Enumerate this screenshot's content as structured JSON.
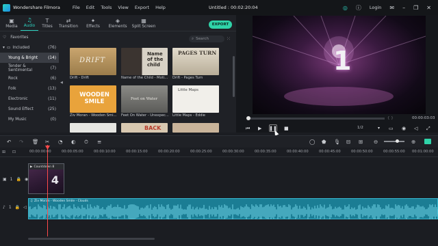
{
  "titlebar": {
    "app_name": "Wondershare Filmora",
    "menus": [
      "File",
      "Edit",
      "Tools",
      "View",
      "Export",
      "Help"
    ],
    "project": "Untitled : 00:02:20:04",
    "login": "Login"
  },
  "tabs": [
    {
      "label": "Media",
      "icon": "▣"
    },
    {
      "label": "Audio",
      "icon": "♫"
    },
    {
      "label": "Titles",
      "icon": "T"
    },
    {
      "label": "Transition",
      "icon": "⇄"
    },
    {
      "label": "Effects",
      "icon": "✦"
    },
    {
      "label": "Elements",
      "icon": "◈"
    },
    {
      "label": "Split Screen",
      "icon": "▦"
    }
  ],
  "export_label": "EXPORT",
  "search_placeholder": "Search",
  "categories": [
    {
      "label": "Favorites",
      "count": ""
    },
    {
      "label": "Included",
      "count": "(76)"
    },
    {
      "label": "Young & Bright",
      "count": "(14)"
    },
    {
      "label": "Tender & Sentimental",
      "count": "(7)"
    },
    {
      "label": "Rock",
      "count": "(6)"
    },
    {
      "label": "Folk",
      "count": "(13)"
    },
    {
      "label": "Electronic",
      "count": "(11)"
    },
    {
      "label": "Sound Effect",
      "count": "(25)"
    },
    {
      "label": "My Music",
      "count": "(0)"
    }
  ],
  "thumbs": [
    {
      "art": "DRIFT",
      "caption": "Drift - Drift"
    },
    {
      "art": "Name of the child",
      "caption": "Name of the Child - Moti..."
    },
    {
      "art": "PAGES TURN",
      "caption": "Drift - Pages Turn"
    },
    {
      "art": "WOODEN SMILE",
      "caption": "Ziv Moran - Wooden Smi..."
    },
    {
      "art": "Feet on Water",
      "caption": "Feet On Water - Unexpec..."
    },
    {
      "art": "Little Maps",
      "caption": "Little Maps - Eddie"
    },
    {
      "art": "",
      "caption": ""
    },
    {
      "art": "BACK",
      "caption": ""
    },
    {
      "art": "",
      "caption": ""
    }
  ],
  "preview": {
    "countdown_number": "1",
    "timecode": "00:00:03:03",
    "ratio": "1/2",
    "brackets": "{   }"
  },
  "ruler_ticks": [
    "00:00:00:00",
    "00:00:05:00",
    "00:00:10:00",
    "00:00:15:00",
    "00:00:20:00",
    "00:00:25:00",
    "00:00:30:00",
    "00:00:35:00",
    "00:00:40:00",
    "00:00:45:00",
    "00:00:50:00",
    "00:00:55:00",
    "00:01:00:00"
  ],
  "tracks": {
    "video_clip_label": "Countdown 8",
    "video_clip_number": "4",
    "audio_clip_label": "Ziv Moran - Wooden Smile - Clouds",
    "video_track_num": "1",
    "audio_track_num": "1"
  },
  "colors": {
    "accent": "#2fd3c1",
    "export": "#2fd3a8",
    "audio_clip": "#1b7d94",
    "playhead": "#ff4a4a"
  }
}
